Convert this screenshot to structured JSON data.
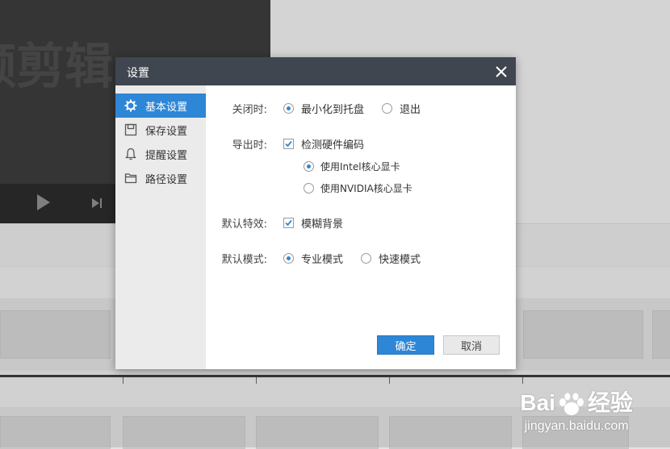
{
  "background": {
    "video_overlay_text": "频剪辑"
  },
  "watermark": {
    "brand_left": "Bai",
    "brand_right": "经验",
    "url": "jingyan.baidu.com"
  },
  "dialog": {
    "title": "设置",
    "sidebar": {
      "items": [
        {
          "label": "基本设置",
          "icon": "gear-icon",
          "active": true
        },
        {
          "label": "保存设置",
          "icon": "save-icon",
          "active": false
        },
        {
          "label": "提醒设置",
          "icon": "bell-icon",
          "active": false
        },
        {
          "label": "路径设置",
          "icon": "folder-icon",
          "active": false
        }
      ]
    },
    "settings": {
      "close": {
        "label": "关闭时:",
        "options": [
          {
            "label": "最小化到托盘",
            "selected": true
          },
          {
            "label": "退出",
            "selected": false
          }
        ]
      },
      "export": {
        "label": "导出时:",
        "detect_hw": {
          "label": "检测硬件编码",
          "checked": true
        },
        "gpu_options": [
          {
            "label": "使用Intel核心显卡",
            "selected": true
          },
          {
            "label": "使用NVIDIA核心显卡",
            "selected": false
          }
        ]
      },
      "effect": {
        "label": "默认特效:",
        "blur_bg": {
          "label": "模糊背景",
          "checked": true
        }
      },
      "mode": {
        "label": "默认模式:",
        "options": [
          {
            "label": "专业模式",
            "selected": true
          },
          {
            "label": "快速模式",
            "selected": false
          }
        ]
      }
    },
    "buttons": {
      "ok": "确定",
      "cancel": "取消"
    }
  },
  "colors": {
    "accent": "#2e86d6",
    "header": "#3f4650"
  }
}
